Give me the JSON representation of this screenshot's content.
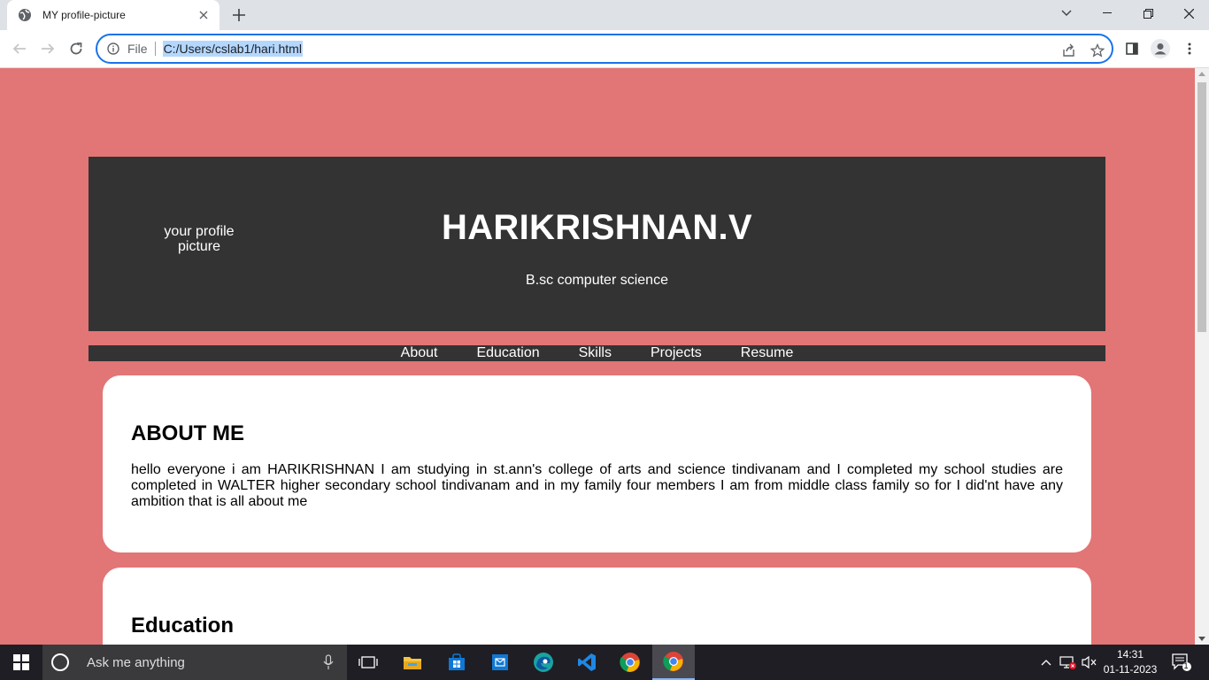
{
  "browser": {
    "tab": {
      "title": "MY profile-picture"
    },
    "address": {
      "scheme_label": "File",
      "url": "C:/Users/cslab1/hari.html"
    }
  },
  "page": {
    "profile_image_alt": "your profile picture",
    "name": "HARIKRISHNAN.V",
    "subtitle": "B.sc computer science",
    "nav": [
      "About",
      "Education",
      "Skills",
      "Projects",
      "Resume"
    ],
    "about": {
      "heading": "ABOUT ME",
      "text": "hello everyone i am HARIKRISHNAN I am studying in st.ann's college of arts and science tindivanam and I completed my school studies are completed in WALTER higher secondary school tindivanam and in my family four members I am from middle class family so for I did'nt have any ambition that is all about me"
    },
    "education": {
      "heading": "Education"
    },
    "colors": {
      "background": "#e27575",
      "header": "#333333",
      "card": "#ffffff"
    }
  },
  "taskbar": {
    "search_placeholder": "Ask me anything",
    "time": "14:31",
    "date": "01-11-2023",
    "notification_count": "1"
  }
}
